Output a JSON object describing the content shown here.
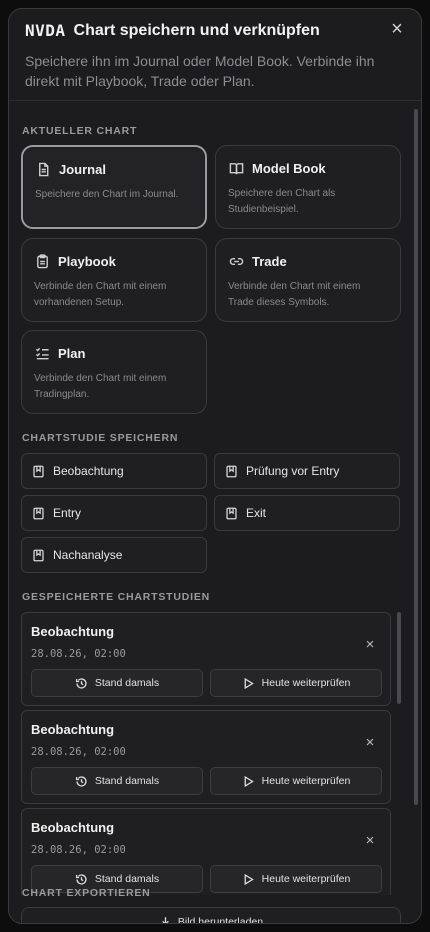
{
  "header": {
    "ticker": "NVDA",
    "title": "Chart speichern und verknüpfen",
    "subtitle": "Speichere ihn im Journal oder Model Book. Verbinde ihn direkt mit Playbook, Trade oder Plan.",
    "close_icon": "×"
  },
  "current_chart": {
    "section_title": "AKTUELLER CHART",
    "cards": [
      {
        "icon": "document-icon",
        "title": "Journal",
        "desc": "Speichere den Chart im Journal."
      },
      {
        "icon": "book-open-icon",
        "title": "Model Book",
        "desc": "Speichere den Chart als Studienbeispiel."
      },
      {
        "icon": "clipboard-icon",
        "title": "Playbook",
        "desc": "Verbinde den Chart mit einem vorhandenen Setup."
      },
      {
        "icon": "link-icon",
        "title": "Trade",
        "desc": "Verbinde den Chart mit einem Trade dieses Symbols."
      },
      {
        "icon": "checklist-icon",
        "title": "Plan",
        "desc": "Verbinde den Chart mit einem Tradingplan."
      }
    ],
    "active": "Journal"
  },
  "chart_study": {
    "section_title": "CHARTSTUDIE SPEICHERN",
    "buttons": [
      "Beobachtung",
      "Prüfung vor Entry",
      "Entry",
      "Exit",
      "Nachanalyse"
    ]
  },
  "saved_studies": {
    "section_title": "GESPEICHERTE CHARTSTUDIEN",
    "items": [
      {
        "title": "Beobachtung",
        "date": "28.08.26, 02:00",
        "btn_past": "Stand damals",
        "btn_today": "Heute weiterprüfen"
      },
      {
        "title": "Beobachtung",
        "date": "28.08.26, 02:00",
        "btn_past": "Stand damals",
        "btn_today": "Heute weiterprüfen"
      },
      {
        "title": "Beobachtung",
        "date": "28.08.26, 02:00",
        "btn_past": "Stand damals",
        "btn_today": "Heute weiterprüfen"
      }
    ]
  },
  "export": {
    "section_title": "CHART EXPORTIEREN",
    "download_label": "Bild herunterladen"
  }
}
